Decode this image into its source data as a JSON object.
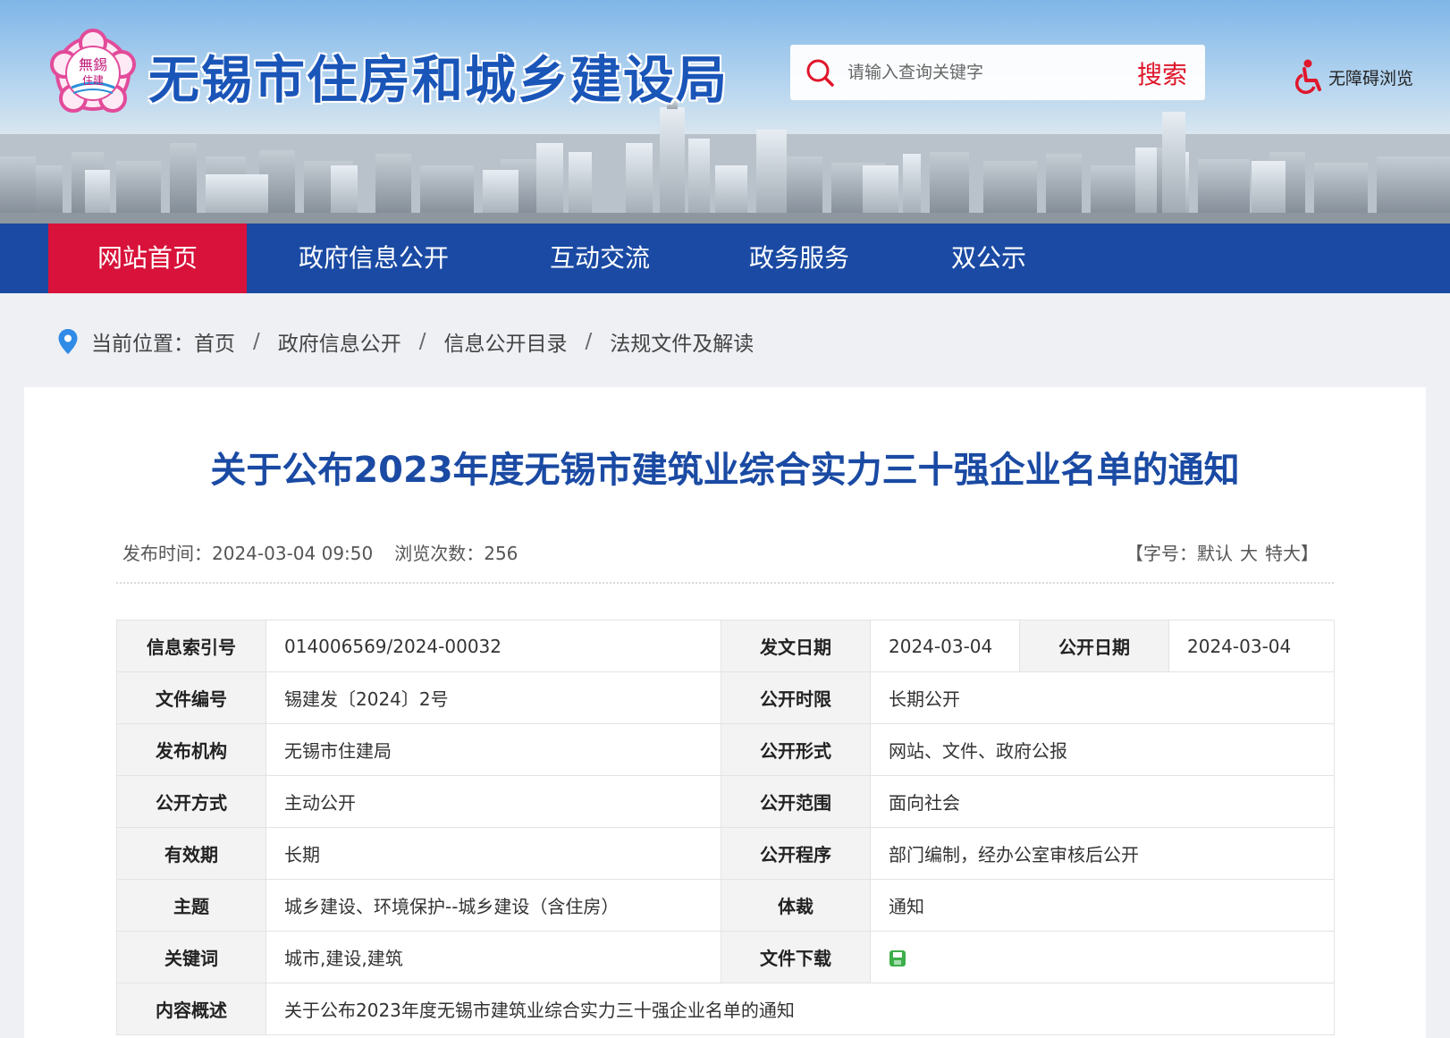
{
  "header": {
    "site_title": "无锡市住房和城乡建设局",
    "search_placeholder": "请输入查询关键字",
    "search_button": "搜索",
    "accessibility": "无障碍浏览"
  },
  "nav": {
    "items": [
      {
        "label": "网站首页",
        "active": true
      },
      {
        "label": "政府信息公开",
        "active": false
      },
      {
        "label": "互动交流",
        "active": false
      },
      {
        "label": "政务服务",
        "active": false
      },
      {
        "label": "双公示",
        "active": false
      }
    ]
  },
  "breadcrumb": {
    "prefix": "当前位置：",
    "items": [
      "首页",
      "政府信息公开",
      "信息公开目录",
      "法规文件及解读"
    ],
    "separator": "/"
  },
  "article": {
    "title": "关于公布2023年度无锡市建筑业综合实力三十强企业名单的通知",
    "publish_label": "发布时间：",
    "publish_time": "2024-03-04 09:50",
    "views_label": "浏览次数：",
    "views": "256",
    "fontsize_prefix": "【字号：",
    "fontsize_default": "默认",
    "fontsize_large": "大",
    "fontsize_xlarge": "特大",
    "fontsize_suffix": "】"
  },
  "info": {
    "index_label": "信息索引号",
    "index_value": "014006569/2024-00032",
    "issue_date_label": "发文日期",
    "issue_date_value": "2024-03-04",
    "public_date_label": "公开日期",
    "public_date_value": "2024-03-04",
    "doc_no_label": "文件编号",
    "doc_no_value": "锡建发〔2024〕2号",
    "limit_label": "公开时限",
    "limit_value": "长期公开",
    "org_label": "发布机构",
    "org_value": "无锡市住建局",
    "form_label": "公开形式",
    "form_value": "网站、文件、政府公报",
    "method_label": "公开方式",
    "method_value": "主动公开",
    "scope_label": "公开范围",
    "scope_value": "面向社会",
    "valid_label": "有效期",
    "valid_value": "长期",
    "procedure_label": "公开程序",
    "procedure_value": "部门编制，经办公室审核后公开",
    "topic_label": "主题",
    "topic_value": "城乡建设、环境保护--城乡建设（含住房）",
    "genre_label": "体裁",
    "genre_value": "通知",
    "keywords_label": "关键词",
    "keywords_value": "城市,建设,建筑",
    "download_label": "文件下载",
    "summary_label": "内容概述",
    "summary_value": "关于公布2023年度无锡市建筑业综合实力三十强企业名单的通知"
  },
  "colors": {
    "nav_bg": "#1a4aa3",
    "nav_active": "#d8123a",
    "title_blue": "#1a4aa3",
    "search_red": "#e0162b"
  }
}
